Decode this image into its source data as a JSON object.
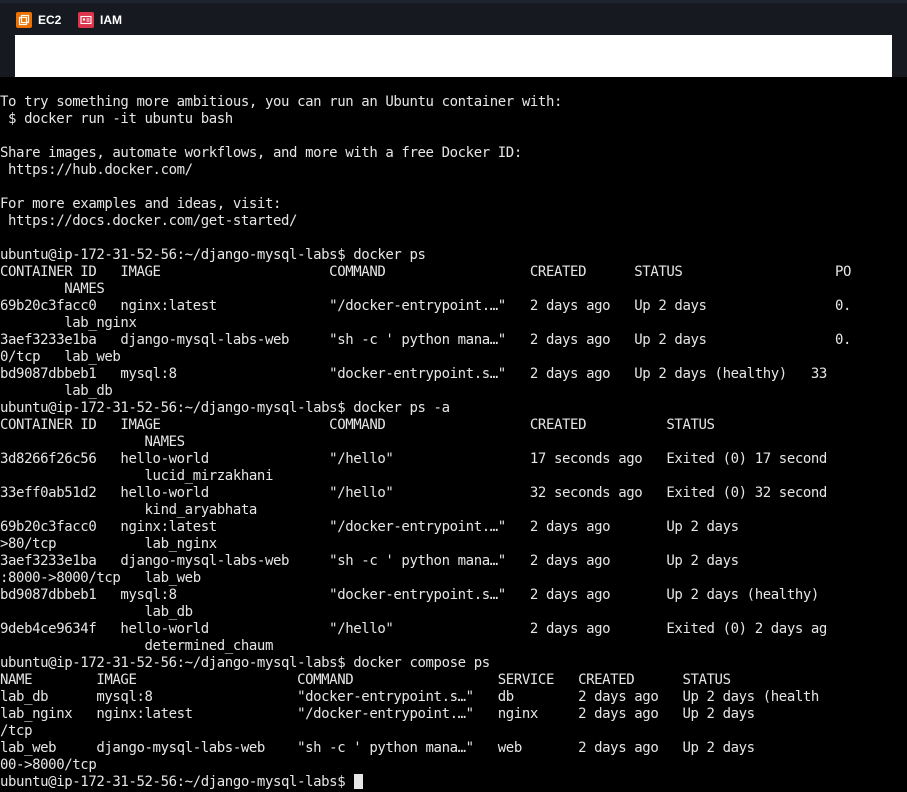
{
  "favorites": [
    {
      "label": "EC2",
      "icon": "ec2-icon",
      "color": "#ed7100"
    },
    {
      "label": "IAM",
      "icon": "iam-icon",
      "color": "#dd344c"
    }
  ],
  "terminal": {
    "lines": [
      "To try something more ambitious, you can run an Ubuntu container with:",
      " $ docker run -it ubuntu bash",
      "",
      "Share images, automate workflows, and more with a free Docker ID:",
      " https://hub.docker.com/",
      "",
      "For more examples and ideas, visit:",
      " https://docs.docker.com/get-started/",
      "",
      "ubuntu@ip-172-31-52-56:~/django-mysql-labs$ docker ps",
      "CONTAINER ID   IMAGE                     COMMAND                  CREATED      STATUS                   PO",
      "        NAMES",
      "69b20c3facc0   nginx:latest              \"/docker-entrypoint.…\"   2 days ago   Up 2 days                0.",
      "        lab_nginx",
      "3aef3233e1ba   django-mysql-labs-web     \"sh -c ' python mana…\"   2 days ago   Up 2 days                0.",
      "0/tcp   lab_web",
      "bd9087dbbeb1   mysql:8                   \"docker-entrypoint.s…\"   2 days ago   Up 2 days (healthy)   33",
      "        lab_db",
      "ubuntu@ip-172-31-52-56:~/django-mysql-labs$ docker ps -a",
      "CONTAINER ID   IMAGE                     COMMAND                  CREATED          STATUS",
      "                  NAMES",
      "3d8266f26c56   hello-world               \"/hello\"                 17 seconds ago   Exited (0) 17 second",
      "                  lucid_mirzakhani",
      "33eff0ab51d2   hello-world               \"/hello\"                 32 seconds ago   Exited (0) 32 second",
      "                  kind_aryabhata",
      "69b20c3facc0   nginx:latest              \"/docker-entrypoint.…\"   2 days ago       Up 2 days",
      ">80/tcp           lab_nginx",
      "3aef3233e1ba   django-mysql-labs-web     \"sh -c ' python mana…\"   2 days ago       Up 2 days",
      ":8000->8000/tcp   lab_web",
      "bd9087dbbeb1   mysql:8                   \"docker-entrypoint.s…\"   2 days ago       Up 2 days (healthy)",
      "                  lab_db",
      "9deb4ce9634f   hello-world               \"/hello\"                 2 days ago       Exited (0) 2 days ag",
      "                  determined_chaum",
      "ubuntu@ip-172-31-52-56:~/django-mysql-labs$ docker compose ps",
      "NAME        IMAGE                    COMMAND                  SERVICE   CREATED      STATUS",
      "lab_db      mysql:8                  \"docker-entrypoint.s…\"   db        2 days ago   Up 2 days (health",
      "lab_nginx   nginx:latest             \"/docker-entrypoint.…\"   nginx     2 days ago   Up 2 days",
      "/tcp",
      "lab_web     django-mysql-labs-web    \"sh -c ' python mana…\"   web       2 days ago   Up 2 days",
      "00->8000/tcp"
    ],
    "prompt": "ubuntu@ip-172-31-52-56:~/django-mysql-labs$ "
  }
}
